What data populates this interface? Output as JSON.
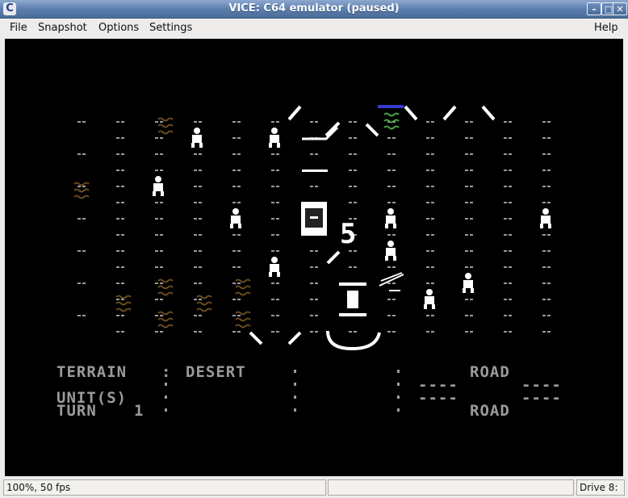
{
  "window": {
    "title": "VICE: C64 emulator (paused)",
    "app_icon_glyph": "C",
    "controls": {
      "minimize": "–",
      "maximize": "□",
      "close": "✕"
    }
  },
  "menu": {
    "items": [
      "File",
      "Snapshot",
      "Options",
      "Settings"
    ],
    "help": "Help"
  },
  "game": {
    "terrain_label": "TERRAIN",
    "terrain_sep": ":",
    "terrain_value": "DESERT",
    "units_label": "UNIT(S)",
    "turn_label": "TURN",
    "turn_value": "1",
    "road_top": "ROAD",
    "road_bottom": "ROAD",
    "dashes": "----",
    "center_number": "5",
    "colors": {
      "text": "#9b9b9b",
      "unit": "#ffffff",
      "bush": "#6b4c1e",
      "water": "#4aa34a",
      "blue": "#3a3ad0"
    }
  },
  "status": {
    "speed": "100%, 50 fps",
    "drive": "Drive 8:"
  }
}
